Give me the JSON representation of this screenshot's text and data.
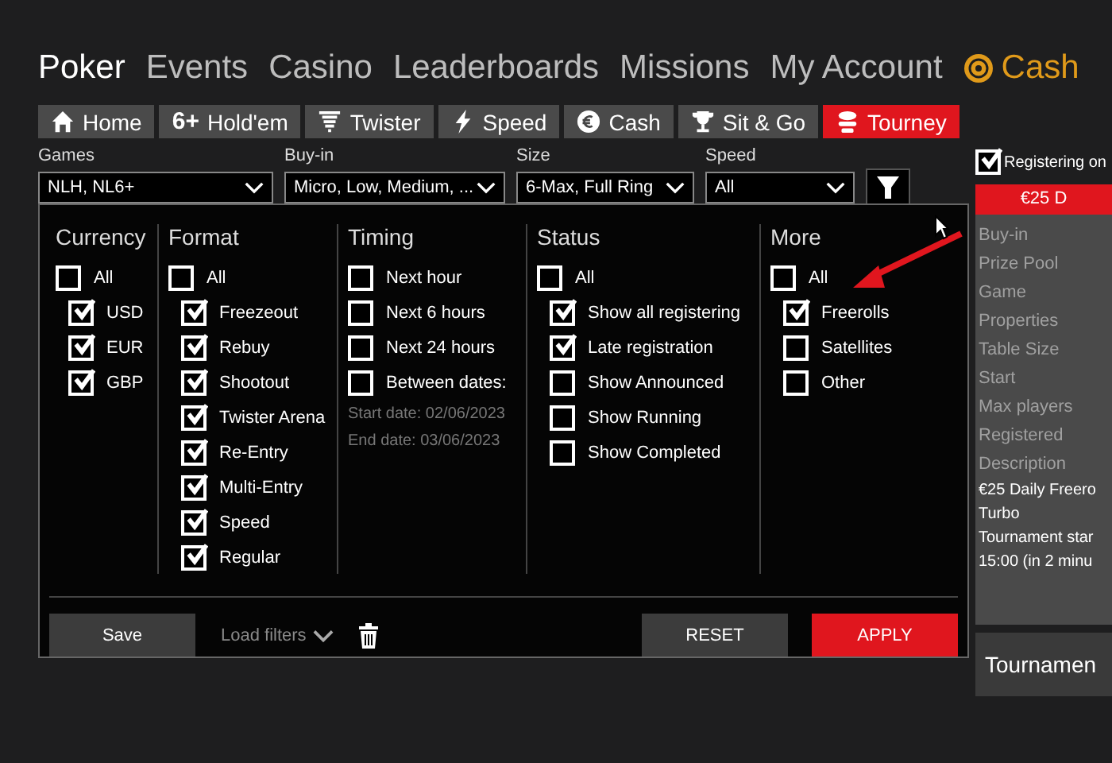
{
  "nav": [
    {
      "label": "Poker",
      "selected": true,
      "kind": "text"
    },
    {
      "label": "Events",
      "selected": false,
      "kind": "text"
    },
    {
      "label": "Casino",
      "selected": false,
      "kind": "text"
    },
    {
      "label": "Leaderboards",
      "selected": false,
      "kind": "text"
    },
    {
      "label": "Missions",
      "selected": false,
      "kind": "text"
    },
    {
      "label": "My Account",
      "selected": false,
      "kind": "text"
    },
    {
      "label": "Cash",
      "selected": false,
      "kind": "coin"
    }
  ],
  "tabs": [
    {
      "label": "Home",
      "kind": "home",
      "selected": false
    },
    {
      "label": "Hold'em",
      "kind": "six",
      "glyph": "6+",
      "selected": false
    },
    {
      "label": "Twister",
      "kind": "twister",
      "selected": false
    },
    {
      "label": "Speed",
      "kind": "bolt",
      "selected": false
    },
    {
      "label": "Cash",
      "kind": "euro",
      "selected": false
    },
    {
      "label": "Sit & Go",
      "kind": "trophy",
      "selected": false
    },
    {
      "label": "Tourney",
      "kind": "tourney",
      "selected": true
    }
  ],
  "filters": [
    {
      "label": "Games",
      "value": "NLH, NL6+"
    },
    {
      "label": "Buy-in",
      "value": "Micro, Low, Medium, ..."
    },
    {
      "label": "Size",
      "value": "6-Max, Full Ring"
    },
    {
      "label": "Speed",
      "value": "All"
    }
  ],
  "panel": {
    "columns": [
      {
        "title": "Currency",
        "items": [
          {
            "label": "All",
            "checked": false,
            "children": [
              {
                "label": "USD",
                "checked": true
              },
              {
                "label": "EUR",
                "checked": true
              },
              {
                "label": "GBP",
                "checked": true
              }
            ]
          }
        ]
      },
      {
        "title": "Format",
        "items": [
          {
            "label": "All",
            "checked": false,
            "children": [
              {
                "label": "Freezeout",
                "checked": true
              },
              {
                "label": "Rebuy",
                "checked": true
              },
              {
                "label": "Shootout",
                "checked": true
              },
              {
                "label": "Twister Arena",
                "checked": true
              },
              {
                "label": "Re-Entry",
                "checked": true
              },
              {
                "label": "Multi-Entry",
                "checked": true
              },
              {
                "label": "Speed",
                "checked": true
              },
              {
                "label": "Regular",
                "checked": true
              }
            ]
          }
        ]
      },
      {
        "title": "Timing",
        "items": [
          {
            "label": "Next hour",
            "checked": false
          },
          {
            "label": "Next 6 hours",
            "checked": false
          },
          {
            "label": "Next 24 hours",
            "checked": false
          },
          {
            "label": "Between dates:",
            "checked": false
          }
        ],
        "notes": [
          "Start date: 02/06/2023",
          "End date: 03/06/2023"
        ]
      },
      {
        "title": "Status",
        "items": [
          {
            "label": "All",
            "checked": false,
            "children": [
              {
                "label": "Show all registering",
                "checked": true
              },
              {
                "label": "Late registration",
                "checked": true
              },
              {
                "label": "Show Announced",
                "checked": false
              },
              {
                "label": "Show Running",
                "checked": false
              },
              {
                "label": "Show Completed",
                "checked": false
              }
            ]
          }
        ]
      },
      {
        "title": "More",
        "items": [
          {
            "label": "All",
            "checked": false,
            "children": [
              {
                "label": "Freerolls",
                "checked": true
              },
              {
                "label": "Satellites",
                "checked": false
              },
              {
                "label": "Other",
                "checked": false
              }
            ]
          }
        ]
      }
    ],
    "save": "Save",
    "load": "Load filters",
    "reset": "RESET",
    "apply": "APPLY"
  },
  "side": {
    "registering": {
      "label": "Registering on",
      "checked": true
    },
    "header": "€25 D",
    "fields": [
      "Buy-in",
      "Prize Pool",
      "Game",
      "Properties",
      "Table Size",
      "Start",
      "Max players",
      "Registered",
      "Description"
    ],
    "description": [
      "€25 Daily Freero",
      "Turbo",
      "Tournament star",
      "15:00 (in 2 minu"
    ],
    "bottom": "Tournamen"
  }
}
